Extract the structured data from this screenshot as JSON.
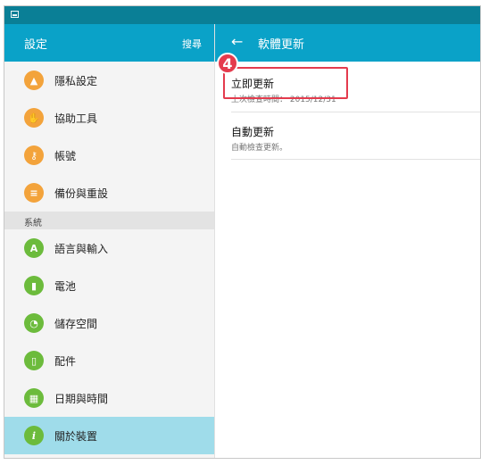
{
  "left_panel": {
    "title": "設定",
    "search_label": "搜尋",
    "items_top": [
      {
        "label": "隱私設定",
        "icon": "privacy-icon",
        "glyph": "▲",
        "color": "#f3a33b"
      },
      {
        "label": "協助工具",
        "icon": "accessibility-hand-icon",
        "glyph": "✋",
        "color": "#f3a33b"
      },
      {
        "label": "帳號",
        "icon": "key-icon",
        "glyph": "⚷",
        "color": "#f3a33b"
      },
      {
        "label": "備份與重設",
        "icon": "backup-icon",
        "glyph": "≡",
        "color": "#f3a33b"
      }
    ],
    "section_label": "系統",
    "items_system": [
      {
        "label": "語言與輸入",
        "icon": "language-icon",
        "glyph": "A",
        "color": "#6cbb3c"
      },
      {
        "label": "電池",
        "icon": "battery-icon",
        "glyph": "▮",
        "color": "#6cbb3c"
      },
      {
        "label": "儲存空間",
        "icon": "storage-icon",
        "glyph": "◔",
        "color": "#6cbb3c"
      },
      {
        "label": "配件",
        "icon": "accessory-icon",
        "glyph": "▯",
        "color": "#6cbb3c"
      },
      {
        "label": "日期與時間",
        "icon": "calendar-icon",
        "glyph": "▦",
        "color": "#6cbb3c"
      },
      {
        "label": "關於裝置",
        "icon": "info-icon",
        "glyph": "i",
        "color": "#6cbb3c",
        "active": true
      }
    ]
  },
  "right_panel": {
    "title": "軟體更新",
    "settings": [
      {
        "title": "立即更新",
        "subtitle": "上次檢查時間： 2015/12/31"
      },
      {
        "title": "自動更新",
        "subtitle": "自動檢查更新。"
      }
    ]
  },
  "annotation": {
    "step": "4",
    "color": "#e43b4d"
  }
}
